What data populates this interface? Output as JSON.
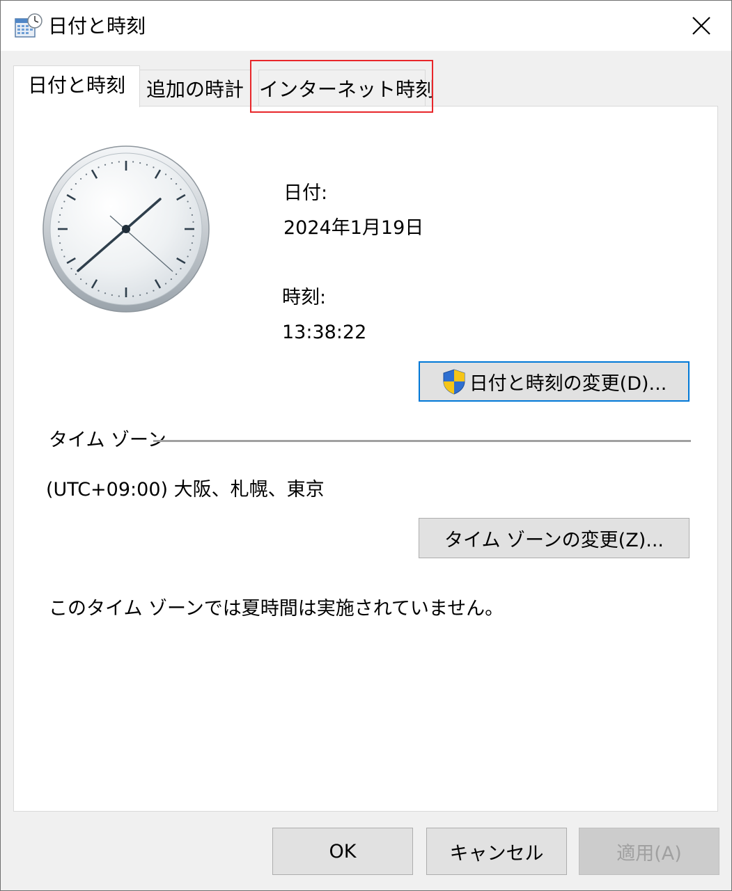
{
  "window": {
    "title": "日付と時刻",
    "close_glyph": "✕"
  },
  "tabs": [
    {
      "label": "日付と時刻",
      "active": true
    },
    {
      "label": "追加の時計",
      "active": false
    },
    {
      "label": "インターネット時刻",
      "active": false,
      "highlighted": true
    }
  ],
  "date_time": {
    "date_label": "日付:",
    "date_value": "2024年1月19日",
    "time_label": "時刻:",
    "time_value": "13:38:22",
    "change_button": "日付と時刻の変更(D)..."
  },
  "time_zone": {
    "section_label": "タイム ゾーン",
    "value": "(UTC+09:00) 大阪、札幌、東京",
    "change_button": "タイム ゾーンの変更(Z)...",
    "dst_note": "このタイム ゾーンでは夏時間は実施されていません。"
  },
  "footer": {
    "ok": "OK",
    "cancel": "キャンセル",
    "apply": "適用(A)"
  },
  "icons": {
    "app": "calendar-clock-icon",
    "uac": "uac-shield-icon"
  },
  "colors": {
    "highlight": "#e8262a",
    "accent": "#0078d7"
  }
}
